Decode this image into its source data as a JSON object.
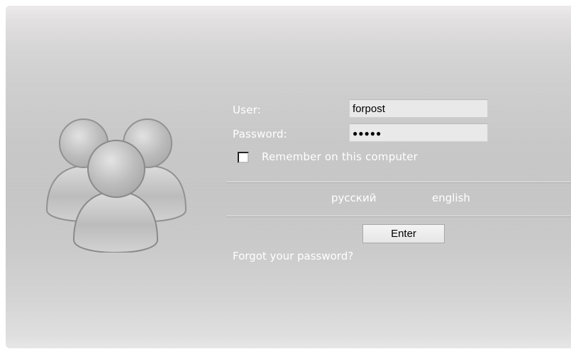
{
  "login": {
    "user_label": "User:",
    "user_value": "forpost",
    "password_label": "Password:",
    "password_value": "●●●●●",
    "remember_label": "Remember on this computer",
    "remember_checked": false
  },
  "languages": {
    "russian": "русский",
    "english": "english"
  },
  "actions": {
    "enter_label": "Enter",
    "forgot_label": "Forgot your password?"
  },
  "graphic": {
    "icon": "users-group-icon"
  },
  "colors": {
    "panel_gray": "#c7c7c7",
    "label_text": "#ffffff",
    "field_bg": "#e9e9e9"
  }
}
